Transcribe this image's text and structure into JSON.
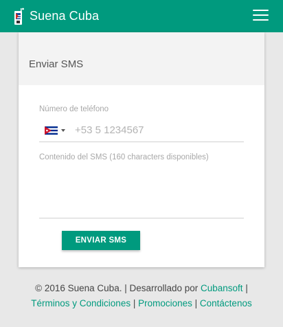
{
  "navbar": {
    "brand": "Suena Cuba",
    "logo_icon": "phone-logo-icon",
    "menu_icon": "hamburger-menu-icon",
    "color": "#009a7e"
  },
  "card": {
    "title": "Enviar SMS",
    "phone_label": "Número de teléfono",
    "phone_placeholder": "+53 5 1234567",
    "country_flag": "cuba-flag-icon",
    "sms_label": "Contenido del SMS (160 characters disponibles)",
    "send_button": "ENVIAR SMS"
  },
  "footer": {
    "copyright": "© 2016 Suena Cuba. | Desarrollado por ",
    "dev_link": "Cubansoft",
    "sep": " |",
    "links": [
      "Términos y Condiciones",
      "Promociones",
      "Contáctenos"
    ],
    "link_sep": " | "
  }
}
